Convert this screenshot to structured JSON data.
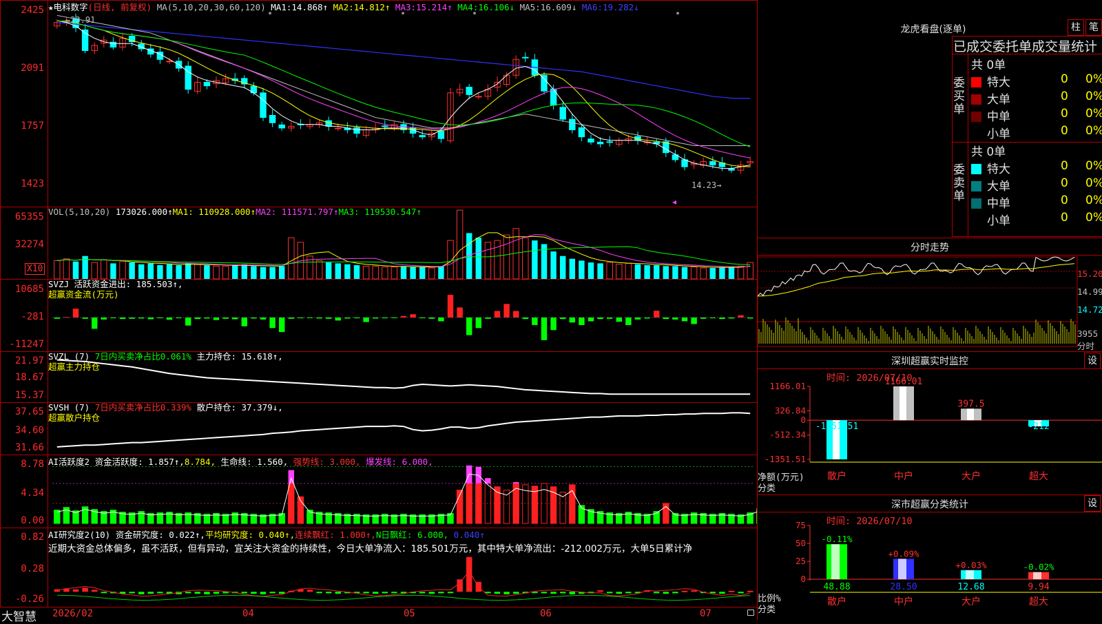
{
  "stock": {
    "star": "★",
    "name": "电科数字",
    "period": "(日线, 前复权)",
    "ma_header": "MA(5,10,20,30,60,120)",
    "ma_values": [
      {
        "label": "MA1:",
        "value": "14.868↑",
        "color": "#ffffff"
      },
      {
        "label": "MA2:",
        "value": "14.812↑",
        "color": "#ffff00"
      },
      {
        "label": "MA3:",
        "value": "15.214↑",
        "color": "#ff40ff"
      },
      {
        "label": "MA4:",
        "value": "16.106↓",
        "color": "#00ff00"
      },
      {
        "label": "MA5:",
        "value": "16.609↓",
        "color": "#c0c0c0"
      },
      {
        "label": "MA6:",
        "value": "19.282↓",
        "color": "#4040ff"
      }
    ]
  },
  "price_panel": {
    "y_ticks": [
      "2425",
      "2091",
      "1757",
      "1423"
    ],
    "high_label": "←23.91",
    "low_label": "14.23→"
  },
  "vol_panel": {
    "header": "VOL(5,10,20)",
    "vol_value": "173026.000↑",
    "ma1": "MA1: 110928.000↑",
    "ma2": "MA2: 111571.797↑",
    "ma3": "MA3: 119530.547↑",
    "y_ticks": [
      "65355",
      "32274"
    ],
    "unit": "X10"
  },
  "svzj_panel": {
    "line1": "SVZJ  活跃资金进出: 185.503↑,",
    "line2": "超赢资金流(万元)",
    "y_ticks": [
      "10685",
      "-281",
      "-11247"
    ]
  },
  "svzl_panel": {
    "prefix": "SVZL (7)",
    "net": "7日内买卖净占比0.061%",
    "hold": "主力持仓: 15.618↑,",
    "line2": "超赢主力持仓",
    "y_ticks": [
      "21.97",
      "18.67",
      "15.37"
    ]
  },
  "svsh_panel": {
    "prefix": "SVSH (7)",
    "net": "7日内买卖净占比0.339%",
    "hold": "散户持仓: 37.379↓,",
    "line2": "超赢散户持仓",
    "y_ticks": [
      "37.65",
      "34.60",
      "31.66"
    ]
  },
  "ai_active": {
    "a": "AI活跃度2 资金活跃度: 1.857↑,",
    "b": "8.784,",
    "c": "生命线: 1.560,",
    "d": "强势线: 3.000,",
    "e": "爆发线: 6.000,",
    "y_ticks": [
      "8.78",
      "4.34",
      "0.00"
    ]
  },
  "ai_research": {
    "a": "AI研究度2(10) 资金研究度: 0.022↑,",
    "b": "平均研究度: 0.040↑,",
    "c": "连续飘红: 1.000↑,",
    "d": "N日飘红: 6.000,",
    "e": "0.040↑",
    "comment": "近期大资金总体偏多，虽不活跃，但有异动，宜关注大资金的持续性，今日大单净流入：185.501万元，其中特大单净流出：-212.002万元，大单5日累计净",
    "y_ticks": [
      "0.82",
      "0.28",
      "-0.26"
    ]
  },
  "x_axis": {
    "labels": [
      "2026/02",
      "04",
      "05",
      "06",
      "07"
    ],
    "brand": "大智慧"
  },
  "dragon": {
    "title": "龙虎看盘(逐单)",
    "btn1": "柱",
    "btn2": "笔",
    "subtitle": "已成交委托单成交量统计",
    "buy_total": "共 0单",
    "sell_total": "共 0单",
    "buy_side": "委买单",
    "sell_side": "委卖单",
    "buy_rows": [
      {
        "label": "特大",
        "n": "0",
        "p": "0%",
        "color": "#ff0000"
      },
      {
        "label": "大单",
        "n": "0",
        "p": "0%",
        "color": "#a00000"
      },
      {
        "label": "中单",
        "n": "0",
        "p": "0%",
        "color": "#700000"
      },
      {
        "label": "小单",
        "n": "0",
        "p": "0%",
        "color": "#000000"
      }
    ],
    "sell_rows": [
      {
        "label": "特大",
        "n": "0",
        "p": "0%",
        "color": "#00ffff"
      },
      {
        "label": "大单",
        "n": "0",
        "p": "0%",
        "color": "#008080"
      },
      {
        "label": "中单",
        "n": "0",
        "p": "0%",
        "color": "#007070"
      },
      {
        "label": "小单",
        "n": "0",
        "p": "0%",
        "color": "#000000"
      }
    ]
  },
  "intraday": {
    "title": "分时走势",
    "price_ticks": [
      "15.20",
      "14.99",
      "14.72"
    ],
    "vol_tick": "3955",
    "vol_unit": "分时"
  },
  "sz_monitor": {
    "title": "深圳超赢实时监控",
    "btn": "设",
    "time": "时间: 2026/07/10",
    "y_ticks": [
      "1166.01",
      "326.84",
      "0",
      "-512.34",
      "-1351.51"
    ],
    "ylabel": "净额(万元)",
    "xlabel": "分类"
  },
  "sz_class": {
    "title": "深市超赢分类统计",
    "btn": "设",
    "time": "时间: 2026/07/10",
    "y_ticks": [
      "75",
      "50",
      "25",
      "0"
    ],
    "ylabel": "比例%",
    "xlabel": "分类"
  },
  "chart_data": [
    {
      "type": "candlestick",
      "title": "电科数字 (日线, 前复权)",
      "ylim": [
        14.23,
        24.25
      ],
      "high": 23.91,
      "low": 14.23,
      "close": [
        23.6,
        23.7,
        23.3,
        22.0,
        22.3,
        22.6,
        22.2,
        22.7,
        22.5,
        22.1,
        21.8,
        21.5,
        21.4,
        21.0,
        19.8,
        20.2,
        20.0,
        20.3,
        20.4,
        20.3,
        20.1,
        19.6,
        18.2,
        17.9,
        17.6,
        17.7,
        17.8,
        17.8,
        17.9,
        17.7,
        17.6,
        17.5,
        17.3,
        17.5,
        17.6,
        17.7,
        17.8,
        17.5,
        17.3,
        17.1,
        17.3,
        17.0,
        19.6,
        19.8,
        19.5,
        19.4,
        19.8,
        20.2,
        20.6,
        21.5,
        21.6,
        20.6,
        19.7,
        18.9,
        18.1,
        17.5,
        17.1,
        16.8,
        16.7,
        16.8,
        16.9,
        17.0,
        16.9,
        16.8,
        16.7,
        16.2,
        15.8,
        15.4,
        15.6,
        15.7,
        15.5,
        15.4,
        15.2,
        15.5,
        15.7
      ],
      "ma5": [
        23.7,
        23.6,
        23.4,
        23.0,
        22.7,
        22.5,
        22.4,
        22.4,
        22.4,
        22.2,
        22.0,
        21.8,
        21.5,
        21.2,
        20.8,
        20.5,
        20.3,
        20.2,
        20.1,
        20.0,
        19.9,
        19.6,
        19.2,
        18.7,
        18.3,
        18.0,
        17.8,
        17.8,
        17.8,
        17.7,
        17.7,
        17.6,
        17.5,
        17.5,
        17.5,
        17.6,
        17.6,
        17.6,
        17.5,
        17.3,
        17.2,
        17.5,
        18.2,
        18.8,
        19.3,
        19.6,
        19.8,
        20.1,
        20.6,
        21.0,
        21.1,
        20.9,
        20.4,
        19.8,
        19.1,
        18.4,
        17.8,
        17.3,
        17.0,
        16.9,
        16.9,
        16.9,
        16.9,
        16.8,
        16.7,
        16.4,
        16.1,
        15.8,
        15.6,
        15.5,
        15.4,
        15.3,
        15.3,
        15.4,
        15.5
      ],
      "ma60": [
        24.0,
        23.9,
        23.8,
        23.7,
        23.6,
        23.5,
        23.4,
        23.3,
        23.2,
        23.1,
        23.0,
        22.8,
        22.6,
        22.4,
        22.2,
        22.0,
        21.8,
        21.6,
        21.4,
        21.2,
        21.0,
        20.8,
        20.6,
        20.4,
        20.2,
        20.0,
        19.8,
        19.6,
        19.4,
        19.2,
        19.0,
        18.8,
        18.6,
        18.4,
        18.2,
        18.1,
        18.0,
        17.9,
        17.8,
        17.7,
        17.6,
        17.6,
        17.6,
        17.7,
        17.8,
        17.9,
        18.0,
        18.1,
        18.2,
        18.3,
        18.4,
        18.3,
        18.2,
        18.1,
        18.0,
        17.9,
        17.8,
        17.7,
        17.6,
        17.5,
        17.4,
        17.3,
        17.2,
        17.1,
        17.0,
        16.9,
        16.8,
        16.7,
        16.6,
        16.6,
        16.6,
        16.6,
        16.6,
        16.6,
        16.6
      ],
      "ma120": [
        23.6,
        23.55,
        23.5,
        23.45,
        23.4,
        23.35,
        23.3,
        23.25,
        23.2,
        23.15,
        23.1,
        23.05,
        23.0,
        22.95,
        22.9,
        22.85,
        22.8,
        22.75,
        22.7,
        22.65,
        22.6,
        22.55,
        22.5,
        22.45,
        22.4,
        22.35,
        22.3,
        22.25,
        22.2,
        22.15,
        22.1,
        22.05,
        22.0,
        21.95,
        21.9,
        21.85,
        21.8,
        21.75,
        21.7,
        21.65,
        21.6,
        21.55,
        21.5,
        21.45,
        21.4,
        21.35,
        21.3,
        21.25,
        21.2,
        21.15,
        21.1,
        21.05,
        21.0,
        20.95,
        20.9,
        20.85,
        20.8,
        20.7,
        20.6,
        20.5,
        20.4,
        20.3,
        20.2,
        20.1,
        20.0,
        19.9,
        19.8,
        19.7,
        19.6,
        19.5,
        19.4,
        19.35,
        19.3,
        19.29,
        19.28
      ]
    },
    {
      "type": "bar",
      "title": "VOL(5,10,20)",
      "ylim": [
        0,
        65355
      ],
      "values": [
        20000,
        22000,
        19000,
        25000,
        18000,
        21000,
        17000,
        19000,
        18000,
        16000,
        17000,
        15000,
        16000,
        15000,
        17000,
        16000,
        15000,
        14000,
        14000,
        15000,
        16000,
        14000,
        13000,
        13000,
        14000,
        45000,
        40000,
        25000,
        20000,
        18000,
        17000,
        16000,
        15000,
        14000,
        14000,
        13000,
        13000,
        14000,
        13000,
        13000,
        12000,
        14000,
        42000,
        75000,
        50000,
        45000,
        40000,
        42000,
        48000,
        55000,
        45000,
        42000,
        38000,
        30000,
        25000,
        22000,
        20000,
        18000,
        17000,
        18000,
        16000,
        17000,
        16000,
        15000,
        15000,
        14000,
        14000,
        13000,
        13000,
        12000,
        12000,
        13000,
        13000,
        14000,
        18000
      ]
    },
    {
      "type": "bar",
      "title": "SVZJ 超赢资金流(万元)",
      "ylim": [
        -11247,
        10685
      ],
      "values": [
        -500,
        200,
        3500,
        -500,
        -4500,
        -800,
        -300,
        -600,
        -500,
        -400,
        -700,
        -300,
        -900,
        -300,
        -3200,
        -600,
        -400,
        -1000,
        -500,
        -700,
        -3500,
        -400,
        -800,
        -4200,
        -5800,
        -500,
        -300,
        -200,
        -400,
        -500,
        -1200,
        -400,
        -300,
        -1800,
        -400,
        -300,
        -200,
        600,
        1300,
        -300,
        -500,
        -1500,
        9000,
        4000,
        -7000,
        -4200,
        -500,
        2600,
        5400,
        2600,
        -600,
        -3000,
        -9000,
        -5000,
        -600,
        -2000,
        -3000,
        -1500,
        -600,
        -500,
        -1700,
        -3000,
        -800,
        -400,
        2700,
        -600,
        -800,
        -1500,
        -2600,
        -500,
        -300,
        -600,
        -400,
        900,
        -400
      ]
    },
    {
      "type": "line",
      "title": "SVZL 超赢主力持仓",
      "ylim": [
        15.37,
        21.97
      ],
      "values": [
        21.9,
        21.8,
        21.7,
        21.6,
        21.4,
        21.2,
        21.0,
        20.8,
        20.6,
        20.3,
        20.0,
        19.7,
        19.4,
        19.2,
        19.0,
        18.8,
        18.6,
        18.5,
        18.4,
        18.3,
        18.2,
        18.1,
        18.0,
        17.9,
        17.8,
        17.7,
        17.6,
        17.5,
        17.4,
        17.3,
        17.2,
        17.1,
        17.0,
        16.9,
        16.8,
        16.8,
        16.7,
        16.8,
        17.2,
        17.4,
        17.3,
        17.2,
        17.1,
        17.2,
        17.3,
        17.2,
        17.1,
        17.0,
        16.8,
        16.6,
        16.4,
        16.3,
        16.2,
        16.1,
        16.0,
        15.9,
        15.8,
        15.7,
        15.7,
        15.6,
        15.6,
        15.6,
        15.6,
        15.6,
        15.6,
        15.6,
        15.6,
        15.6,
        15.6,
        15.6,
        15.6,
        15.6,
        15.6,
        15.6,
        15.6
      ]
    },
    {
      "type": "line",
      "title": "SVSH 超赢散户持仓",
      "ylim": [
        31.66,
        37.65
      ],
      "values": [
        32.0,
        32.1,
        32.2,
        32.3,
        32.3,
        32.4,
        32.5,
        32.6,
        32.7,
        32.7,
        32.8,
        32.9,
        33.0,
        33.1,
        33.2,
        33.3,
        33.4,
        33.5,
        33.6,
        33.7,
        33.8,
        33.9,
        34.0,
        34.2,
        34.3,
        34.4,
        34.6,
        34.7,
        34.8,
        34.9,
        35.0,
        35.1,
        35.2,
        35.3,
        35.3,
        35.3,
        35.4,
        35.3,
        34.8,
        34.6,
        34.7,
        34.9,
        35.2,
        35.2,
        35.0,
        35.1,
        35.4,
        35.6,
        35.8,
        36.0,
        36.1,
        36.2,
        36.3,
        36.4,
        36.5,
        36.6,
        36.7,
        36.8,
        36.8,
        36.9,
        37.0,
        37.0,
        37.0,
        37.1,
        37.1,
        37.2,
        37.2,
        37.3,
        37.3,
        37.4,
        37.4,
        37.4,
        37.5,
        37.5,
        37.4
      ]
    },
    {
      "type": "bar",
      "title": "AI活跃度2",
      "ylim": [
        0,
        8.78
      ],
      "values": [
        2.0,
        2.4,
        1.9,
        2.5,
        2.1,
        1.8,
        2.0,
        1.7,
        1.6,
        1.8,
        1.5,
        1.6,
        1.7,
        1.5,
        1.6,
        1.5,
        1.4,
        1.5,
        1.4,
        1.6,
        1.5,
        1.4,
        1.3,
        1.4,
        1.5,
        8.0,
        4.0,
        2.0,
        1.7,
        1.6,
        1.5,
        1.4,
        1.4,
        1.3,
        1.3,
        1.4,
        1.3,
        1.4,
        1.3,
        1.3,
        1.3,
        1.4,
        1.5,
        5.0,
        8.7,
        8.5,
        6.8,
        5.5,
        5.0,
        6.2,
        5.8,
        5.6,
        6.0,
        5.5,
        4.7,
        5.8,
        2.7,
        2.1,
        1.8,
        1.6,
        1.5,
        1.7,
        1.5,
        1.4,
        1.8,
        3.0,
        1.5,
        1.4,
        1.6,
        1.5,
        1.4,
        1.5,
        1.4,
        1.3,
        1.6,
        2.2
      ]
    },
    {
      "type": "bar",
      "title": "AI研究度2(10)",
      "ylim": [
        -0.26,
        0.82
      ],
      "values": [
        0.05,
        0.06,
        0.05,
        0.08,
        0.04,
        -0.02,
        -0.03,
        -0.04,
        -0.03,
        -0.05,
        -0.04,
        -0.03,
        -0.04,
        -0.05,
        -0.03,
        -0.04,
        -0.05,
        -0.04,
        -0.03,
        -0.02,
        -0.03,
        -0.04,
        -0.05,
        -0.03,
        -0.04,
        0.02,
        0.05,
        0.04,
        -0.02,
        -0.03,
        -0.04,
        -0.03,
        -0.02,
        -0.03,
        -0.04,
        -0.03,
        -0.02,
        -0.03,
        -0.02,
        -0.03,
        -0.04,
        -0.03,
        -0.02,
        0.25,
        0.7,
        0.2,
        -0.03,
        -0.04,
        -0.05,
        -0.04,
        -0.03,
        -0.02,
        -0.03,
        -0.04,
        -0.03,
        -0.05,
        -0.04,
        -0.02,
        0.03,
        -0.03,
        -0.04,
        -0.03,
        -0.02,
        0.03,
        -0.03,
        -0.04,
        -0.03,
        0.02,
        0.03,
        -0.02,
        -0.03,
        -0.04,
        0.02,
        -0.03,
        0.02
      ]
    },
    {
      "type": "bar",
      "title": "深圳超赢实时监控",
      "categories": [
        "散户",
        "中户",
        "大户",
        "超大"
      ],
      "values": [
        -1351.51,
        1166.01,
        397.5,
        -212
      ],
      "ylabel": "净额(万元)",
      "ylim": [
        -1351.51,
        1166.01
      ]
    },
    {
      "type": "bar",
      "title": "深市超赢分类统计",
      "categories": [
        "散户",
        "中户",
        "大户",
        "超大"
      ],
      "values": [
        48.88,
        28.5,
        12.68,
        9.94
      ],
      "changes": [
        "-0.11%",
        "+0.09%",
        "+0.03%",
        "-0.02%"
      ],
      "ylabel": "比例%",
      "ylim": [
        0,
        75
      ]
    }
  ]
}
